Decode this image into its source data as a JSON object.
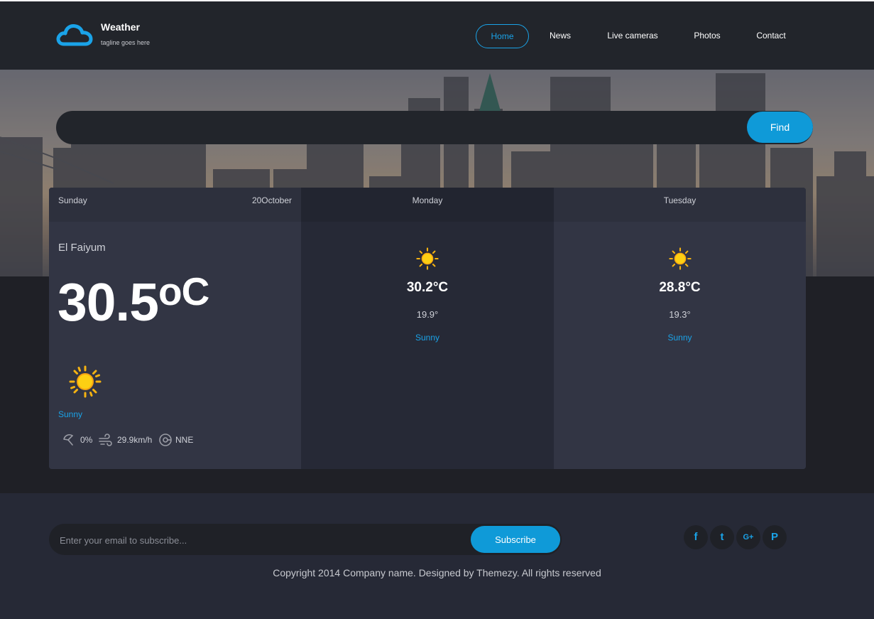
{
  "brand": {
    "title": "Weather",
    "tagline": "tagline goes here"
  },
  "nav": {
    "items": [
      "Home",
      "News",
      "Live cameras",
      "Photos",
      "Contact"
    ],
    "active": "Home"
  },
  "search": {
    "placeholder": "",
    "button": "Find"
  },
  "today": {
    "day": "Sunday",
    "date": "20October",
    "location": "El Faiyum",
    "temp": "30.5",
    "unit": "oC",
    "condition": "Sunny",
    "precipitation": "0%",
    "wind_speed": "29.9km/h",
    "wind_direction": "NNE",
    "icon": "sun-icon"
  },
  "forecast": [
    {
      "day": "Monday",
      "high": "30.2°C",
      "low": "19.9°",
      "condition": "Sunny",
      "icon": "sun-icon"
    },
    {
      "day": "Tuesday",
      "high": "28.8°C",
      "low": "19.3°",
      "condition": "Sunny",
      "icon": "sun-icon"
    }
  ],
  "footer": {
    "subscribe_placeholder": "Enter your email to subscribe...",
    "subscribe_button": "Subscribe",
    "social": [
      "f",
      "t",
      "G+",
      "P"
    ],
    "copyright": "Copyright 2014 Company name. Designed by Themezy. All rights reserved"
  },
  "colors": {
    "accent": "#0f9ad8",
    "header": "#22252b",
    "panel": "#323544",
    "panel_alt": "#262936"
  }
}
